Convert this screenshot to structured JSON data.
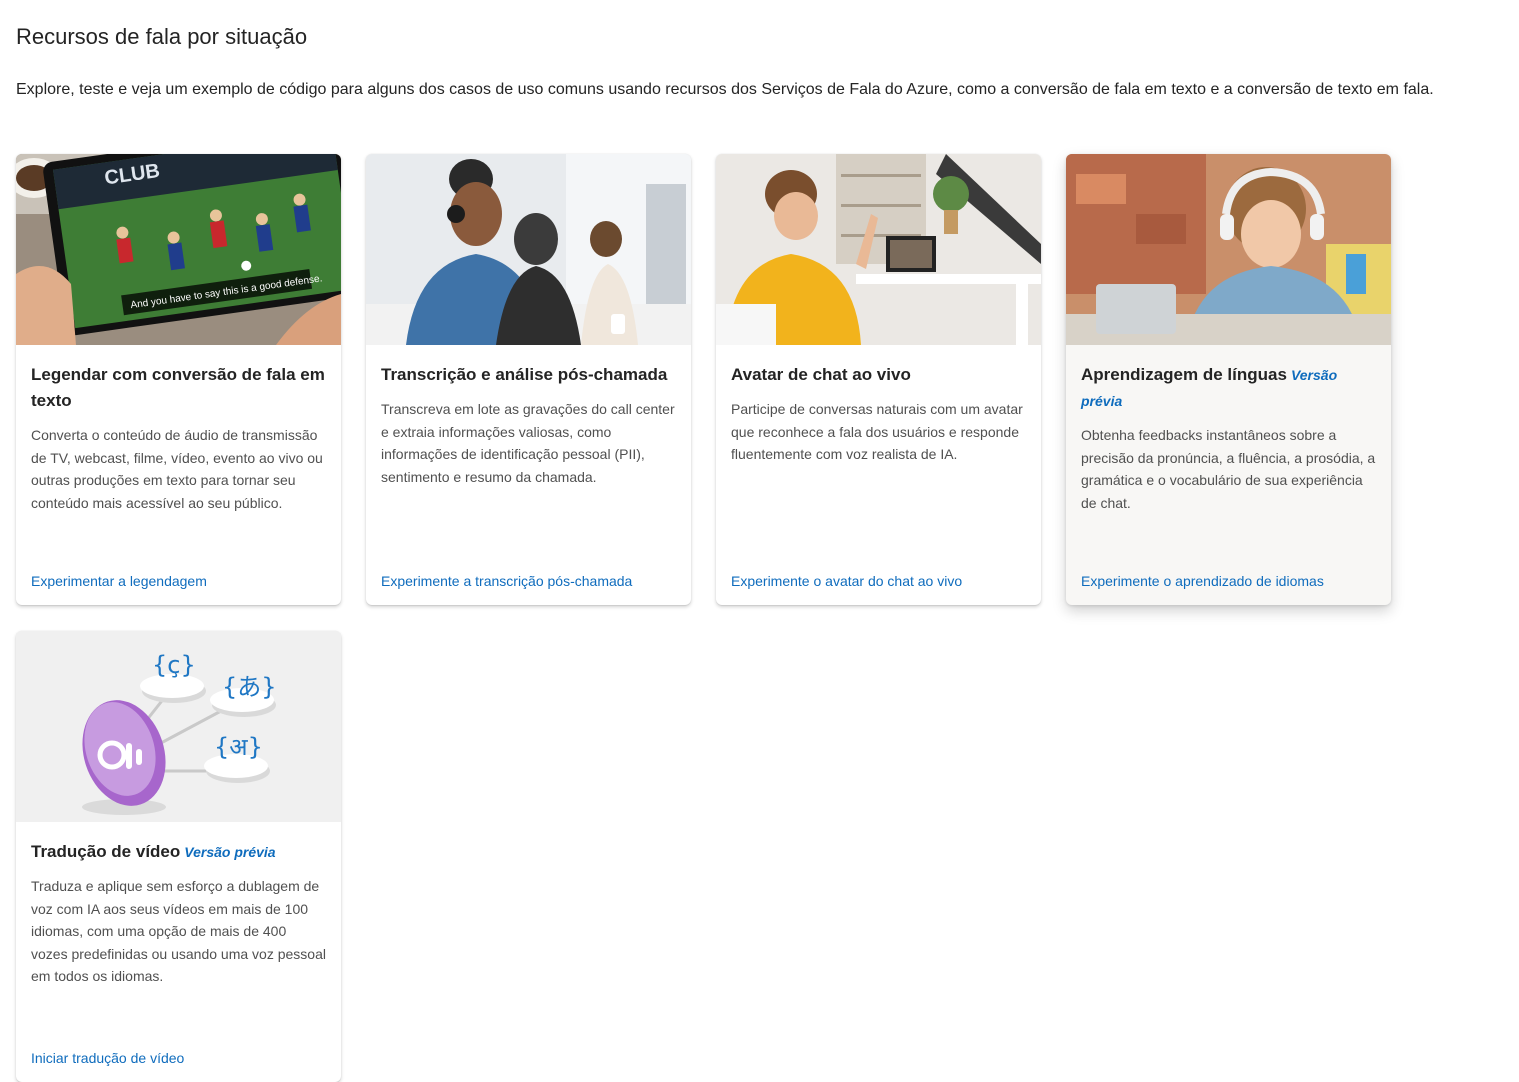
{
  "header": {
    "title": "Recursos de fala por situação",
    "description": "Explore, teste e veja um exemplo de código para alguns dos casos de uso comuns usando recursos dos Serviços de Fala do Azure, como a conversão de fala em texto e a conversão de texto em fala."
  },
  "cards": [
    {
      "title": "Legendar com conversão de fala em texto",
      "badge": "",
      "description": "Converta o conteúdo de áudio de transmissão de TV, webcast, filme, vídeo, evento ao vivo ou outras produções em texto para tornar seu conteúdo mais acessível ao seu público.",
      "link": "Experimentar a legendagem",
      "image_caption": "And you have to say this is a good defense.",
      "image_sign": "CLUB"
    },
    {
      "title": "Transcrição e análise pós-chamada",
      "badge": "",
      "description": "Transcreva em lote as gravações do call center e extraia informações valiosas, como informações de identificação pessoal (PII), sentimento e resumo da chamada.",
      "link": "Experimente a transcrição pós-chamada"
    },
    {
      "title": "Avatar de chat ao vivo",
      "badge": "",
      "description": "Participe de conversas naturais com um avatar que reconhece a fala dos usuários e responde fluentemente com voz realista de IA.",
      "link": "Experimente o avatar do chat ao vivo"
    },
    {
      "title": "Aprendizagem de línguas",
      "badge": "Versão prévia",
      "description": "Obtenha feedbacks instantâneos sobre a precisão da pronúncia, a fluência, a prosódia, a gramática e o vocabulário de sua experiência de chat.",
      "link": "Experimente o aprendizado de idiomas"
    },
    {
      "title": "Tradução de vídeo",
      "badge": "Versão prévia",
      "description": "Traduza e aplique sem esforço a dublagem de voz com IA aos seus vídeos em mais de 100 idiomas, com uma opção de mais de 400 vozes predefinidas ou usando uma voz pessoal em todos os idiomas.",
      "link": "Iniciar tradução de vídeo",
      "image_glyphs": [
        "{ç}",
        "{あ}",
        "{अ}"
      ]
    }
  ],
  "colors": {
    "link": "#0f6cbd",
    "text": "#242424",
    "muted": "#505050"
  }
}
